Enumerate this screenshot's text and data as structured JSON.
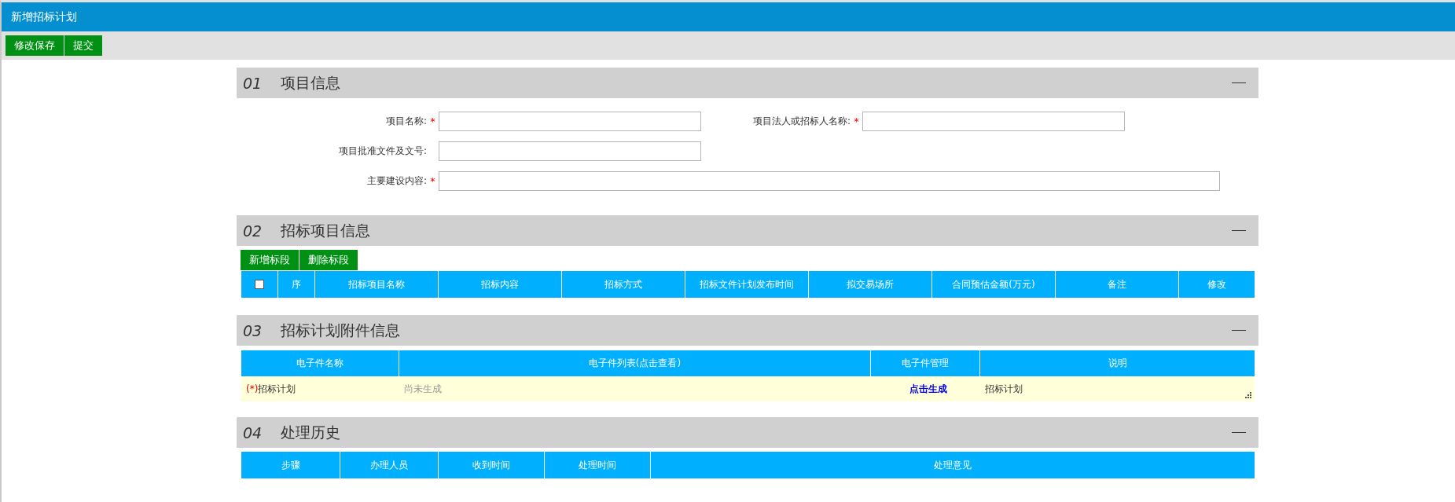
{
  "window": {
    "title": "新增招标计划"
  },
  "toolbar": {
    "buttons": [
      "修改保存",
      "提交"
    ]
  },
  "sections": [
    {
      "number": "01",
      "title": "项目信息",
      "expanded": true,
      "kind": "form",
      "rows": [
        [
          {
            "label": "项目名称:",
            "mark": "*",
            "kind": "short"
          },
          {
            "label": "项目法人或招标人名称:",
            "mark": "*",
            "kind": "short"
          }
        ],
        [
          {
            "label": "项目批准文件及文号:",
            "kind": "short"
          }
        ],
        [
          {
            "label": "主要建设内容:",
            "mark": "*",
            "kind": "long"
          }
        ]
      ]
    },
    {
      "number": "02",
      "title": "招标项目信息",
      "expanded": true,
      "kind": "grid",
      "buttons": [
        "新增标段",
        "删除标段"
      ],
      "select_all": {
        "checked": false
      },
      "columns": [
        "序",
        "招标项目名称",
        "招标内容",
        "招标方式",
        "招标文件计划发布时间",
        "拟交易场所",
        "合同预估金额(万元)",
        "备注",
        "修改"
      ]
    },
    {
      "number": "03",
      "title": "招标计划附件信息",
      "expanded": true,
      "kind": "attachments",
      "columns": [
        "电子件名称",
        "电子件列表(点击查看)",
        "电子件管理",
        "说明"
      ],
      "rows": [
        {
          "required_mark": "(*)",
          "name": "招标计划",
          "files": "尚未生成",
          "action": "点击生成",
          "note": "招标计划"
        }
      ]
    },
    {
      "number": "04",
      "title": "处理历史",
      "expanded": true,
      "kind": "history",
      "columns": [
        "步骤",
        "办理人员",
        "收到时间",
        "处理时间",
        "处理意见"
      ]
    }
  ]
}
